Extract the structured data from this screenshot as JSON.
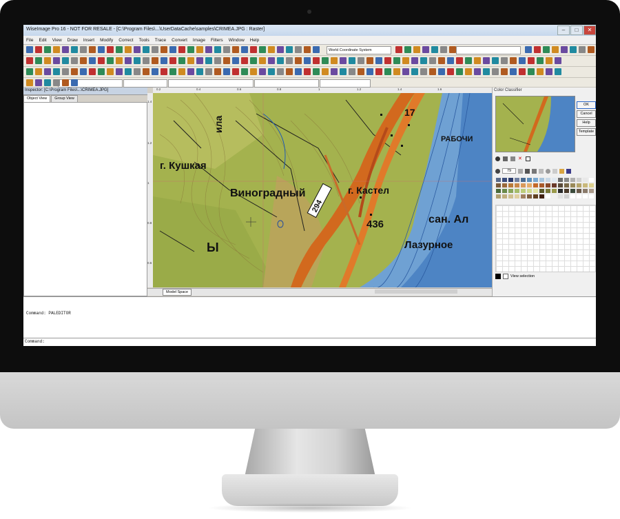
{
  "app": {
    "title": "WiseImage Pro 16 - NOT FOR RESALE - [C:\\Program Files\\...\\UserDataCache\\samples\\CRIMEA.JPG : Raster]",
    "window_controls": [
      "–",
      "□",
      "✕"
    ]
  },
  "menu": [
    "File",
    "Edit",
    "View",
    "Draw",
    "Insert",
    "Modify",
    "Correct",
    "Tools",
    "Trace",
    "Convert",
    "Image",
    "Filters",
    "Window",
    "Help"
  ],
  "toolbar": {
    "coord_system": "World Coordinate System"
  },
  "inspector": {
    "title": "Inspector: [C:\\Program Files\\...\\CRIMEA.JPG]",
    "tabs": [
      "Object View",
      "Group View"
    ]
  },
  "canvas": {
    "ruler_h_ticks": [
      "0.2",
      "0.4",
      "0.6",
      "0.8",
      "1",
      "1.2",
      "1.4",
      "1.6"
    ],
    "ruler_v_ticks": [
      "1.4",
      "1.2",
      "1",
      "0.8",
      "0.6"
    ],
    "map_labels": {
      "kushkaya": "г. Кушкая",
      "vinogradny": "Виноградный",
      "kastel": "г. Кастел",
      "rabochi": "РАБОЧИ",
      "num_436": "436",
      "num_294": "294",
      "num_17": "17",
      "lazurnoe": "Лазурное",
      "san_al": "сан. Ал",
      "ila": "ила",
      "y": "Ы"
    },
    "model_tab": "Model Space"
  },
  "classifier": {
    "title": "Color Classifier",
    "buttons": [
      "OK",
      "Cancel",
      "Help",
      "Template"
    ],
    "zoom": "79",
    "view_selection": "View selection",
    "palette": [
      "#5a6a8a",
      "#3b4c7a",
      "#2a3a6a",
      "#7080a0",
      "#4a6a90",
      "#5b8db8",
      "#79a8d0",
      "#a7c4dc",
      "#c9d9e6",
      "#e0e8f0",
      "#6b6b6b",
      "#8a8a8a",
      "#b0b0b0",
      "#d0d0d0",
      "#e8e8e8",
      "#ffffff",
      "#7a5a3a",
      "#9a6a3a",
      "#b87a3a",
      "#c9884a",
      "#d99a5a",
      "#e6ad6a",
      "#c46a2a",
      "#a85a2a",
      "#8a4a2a",
      "#6a3a2a",
      "#5a4a3a",
      "#7a6a4a",
      "#9a8a5a",
      "#b5a46a",
      "#c9b87a",
      "#ddd08e",
      "#4a6a3a",
      "#6a8a4a",
      "#8aa65a",
      "#a6bd6a",
      "#bccd7a",
      "#cfd98e",
      "#e2e6a6",
      "#5a5a2a",
      "#7a7a3a",
      "#9a9a4a",
      "#2a2a2a",
      "#4a3a2a",
      "#3a4a3a",
      "#6a5a4a",
      "#8a7a6a",
      "#aa9a8a",
      "#b0a070",
      "#c0b080",
      "#d0c090",
      "#e0d0a0",
      "#a08060",
      "#806040",
      "#604020",
      "#402010",
      "#ffffff",
      "#f0f0f0",
      "#e0e0e0",
      "#d0d0d0",
      "#ffffff",
      "#ffffff",
      "#ffffff",
      "#ffffff"
    ]
  },
  "command": {
    "history": "Command: PALEDITOR",
    "prompt": "Command:"
  }
}
